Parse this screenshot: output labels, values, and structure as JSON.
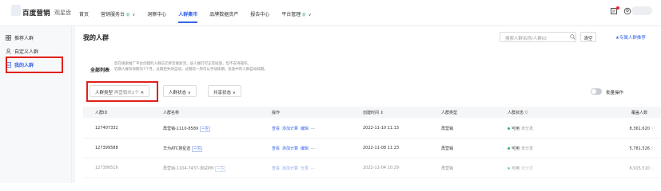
{
  "brand": {
    "name": "百度营销",
    "sub": "观星盘"
  },
  "nav": [
    {
      "label": "首页",
      "active": false
    },
    {
      "label": "营销服务台",
      "badge": "新",
      "chev": true,
      "active": false
    },
    {
      "label": "洞察中心",
      "active": false
    },
    {
      "label": "人群集市",
      "active": true
    },
    {
      "label": "品牌数据资产",
      "active": false
    },
    {
      "label": "报告中心",
      "active": false
    },
    {
      "label": "平台管理",
      "badge": "新",
      "chev": true,
      "active": false
    }
  ],
  "sidebar": {
    "items": [
      {
        "label": "推荐人群",
        "icon": "grid-icon"
      },
      {
        "label": "自定义人群",
        "icon": "user-icon"
      },
      {
        "label": "我的人群",
        "icon": "list-icon",
        "active": true
      }
    ]
  },
  "page": {
    "title": "我的人群",
    "search_placeholder": "搜索人群名称/人群ID",
    "clear_label": "清空",
    "rec_link": "★专属人群推荐",
    "tab_all": "全部列表",
    "notice_line1": "您在搜索推广平台创建的人群已迁移至搜索流，该人群仍可正常投放，但不支持操作。",
    "notice_line2": "近期人群有效期为7个月，过期后失效自动，过期前一周可以手动续期，投放中的人群自动续期。",
    "filters": [
      {
        "label": "人群类型",
        "value": "再营销共1个",
        "close": "✕"
      },
      {
        "label": "人群状态",
        "chev": "∨"
      },
      {
        "label": "共享状态",
        "chev": "∨"
      }
    ],
    "batch_label": "批量操作"
  },
  "table": {
    "headers": [
      "人群ID",
      "人群名称",
      "操作",
      "创建时间 ⇕",
      "人群类型",
      "人群状态 ▽",
      "覆盖人数"
    ],
    "rows": [
      {
        "id": "127407332",
        "name": "再营销-1110-8589",
        "tag": "一方",
        "ops": [
          "查看",
          "添加计算",
          "编辑",
          "···"
        ],
        "time": "2022-11-10 11:13",
        "type": "再营销",
        "status": "可用",
        "share": "未分发",
        "coverage": "8,361,620"
      },
      {
        "id": "127399588",
        "name": "华为ATC搜星选",
        "tag": "一方",
        "ops": [
          "查看",
          "添加计算",
          "编辑",
          "···"
        ],
        "time": "2022-11-08 11:23",
        "type": "再营销",
        "status": "可用",
        "share": "未分发",
        "coverage": "5,781,526"
      },
      {
        "id": "127386516",
        "name": "再营销-1104-7437-测试PM",
        "tag": "一方",
        "ops": [
          "查看",
          "添加计算",
          "分发",
          "···"
        ],
        "time": "2022-11-04 10:29",
        "type": "再营销",
        "status": "可用",
        "share": "未分发",
        "coverage": "6,915,510"
      }
    ]
  }
}
